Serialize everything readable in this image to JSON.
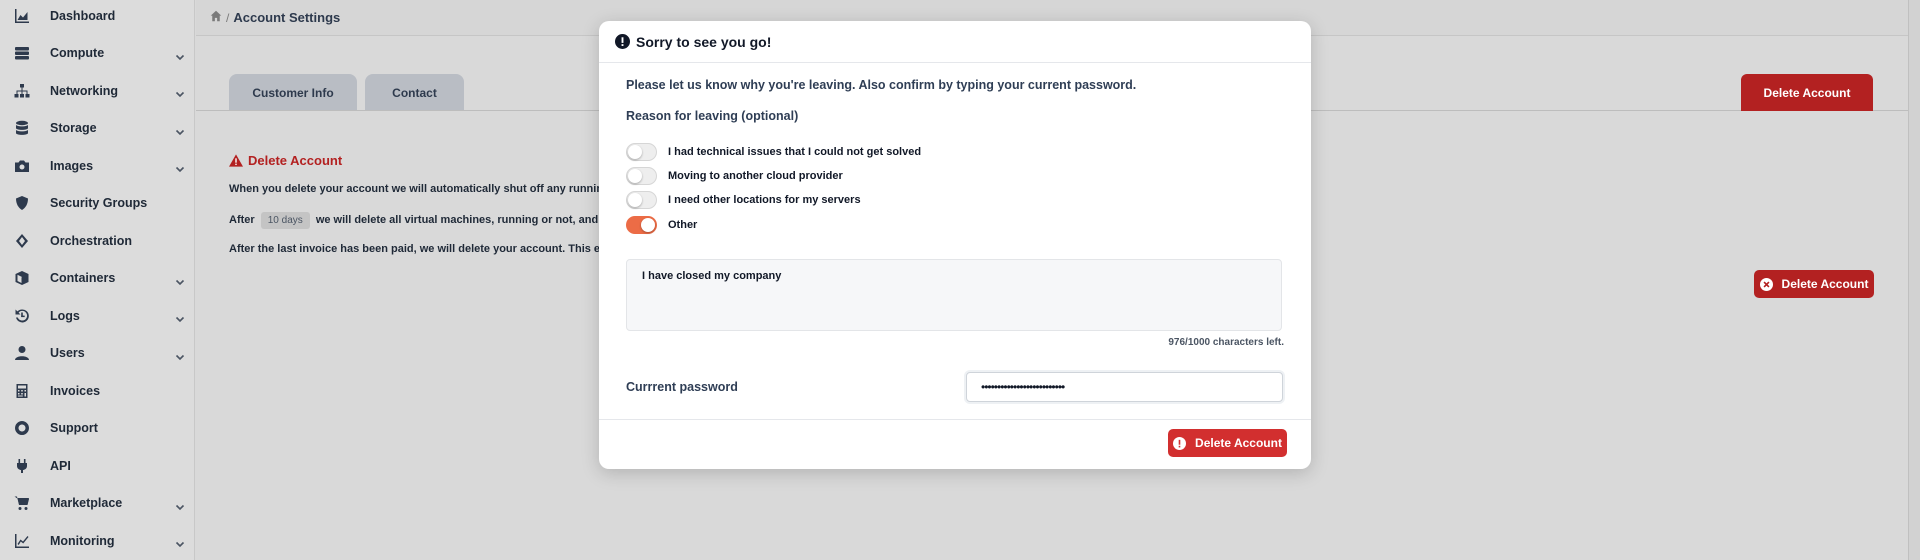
{
  "sidebar": {
    "items": [
      {
        "label": "Dashboard",
        "icon": "chart-area-icon",
        "chevron": false
      },
      {
        "label": "Compute",
        "icon": "server-icon",
        "chevron": true
      },
      {
        "label": "Networking",
        "icon": "sitemap-icon",
        "chevron": true
      },
      {
        "label": "Storage",
        "icon": "database-icon",
        "chevron": true
      },
      {
        "label": "Images",
        "icon": "camera-icon",
        "chevron": true
      },
      {
        "label": "Security Groups",
        "icon": "shield-icon",
        "chevron": false
      },
      {
        "label": "Orchestration",
        "icon": "orchestration-icon",
        "chevron": false
      },
      {
        "label": "Containers",
        "icon": "cube-icon",
        "chevron": true
      },
      {
        "label": "Logs",
        "icon": "history-icon",
        "chevron": true
      },
      {
        "label": "Users",
        "icon": "user-icon",
        "chevron": true
      },
      {
        "label": "Invoices",
        "icon": "calculator-icon",
        "chevron": false
      },
      {
        "label": "Support",
        "icon": "life-ring-icon",
        "chevron": false
      },
      {
        "label": "API",
        "icon": "plug-icon",
        "chevron": false
      },
      {
        "label": "Marketplace",
        "icon": "cart-icon",
        "chevron": true
      },
      {
        "label": "Monitoring",
        "icon": "chart-line-icon",
        "chevron": true
      }
    ]
  },
  "header": {
    "breadcrumb_sep": "/",
    "breadcrumb": "Account Settings"
  },
  "tabs": [
    {
      "label": "Customer Info"
    },
    {
      "label": "Contact"
    }
  ],
  "page": {
    "delete_tab_label": "Delete Account",
    "section_title": "Delete Account",
    "para1": "When you delete your account we will automatically shut off any running virtua",
    "para2_before": "After",
    "para2_badge": "10 days",
    "para2_after": "we will delete all virtual machines, running or not, and all other",
    "para3": "After the last invoice has been paid, we will delete your account. This entire pro",
    "delete_button_label": "Delete Account"
  },
  "modal": {
    "title": "Sorry to see you go!",
    "intro": "Please let us know why you're leaving. Also confirm by typing your current password.",
    "reason_label": "Reason for leaving (optional)",
    "options": [
      {
        "label": "I had technical issues that I could not get solved",
        "checked": false
      },
      {
        "label": "Moving to another cloud provider",
        "checked": false
      },
      {
        "label": "I need other locations for my servers",
        "checked": false
      },
      {
        "label": "Other",
        "checked": true
      }
    ],
    "comment_value": "I have closed my company",
    "chars_left": "976/1000 characters left.",
    "password_label": "Currrent password",
    "password_value": "••••••••••••••••••••••••••",
    "submit_label": "Delete Account"
  },
  "colors": {
    "danger": "#b32121",
    "toggle_on": "#ec6c46"
  }
}
